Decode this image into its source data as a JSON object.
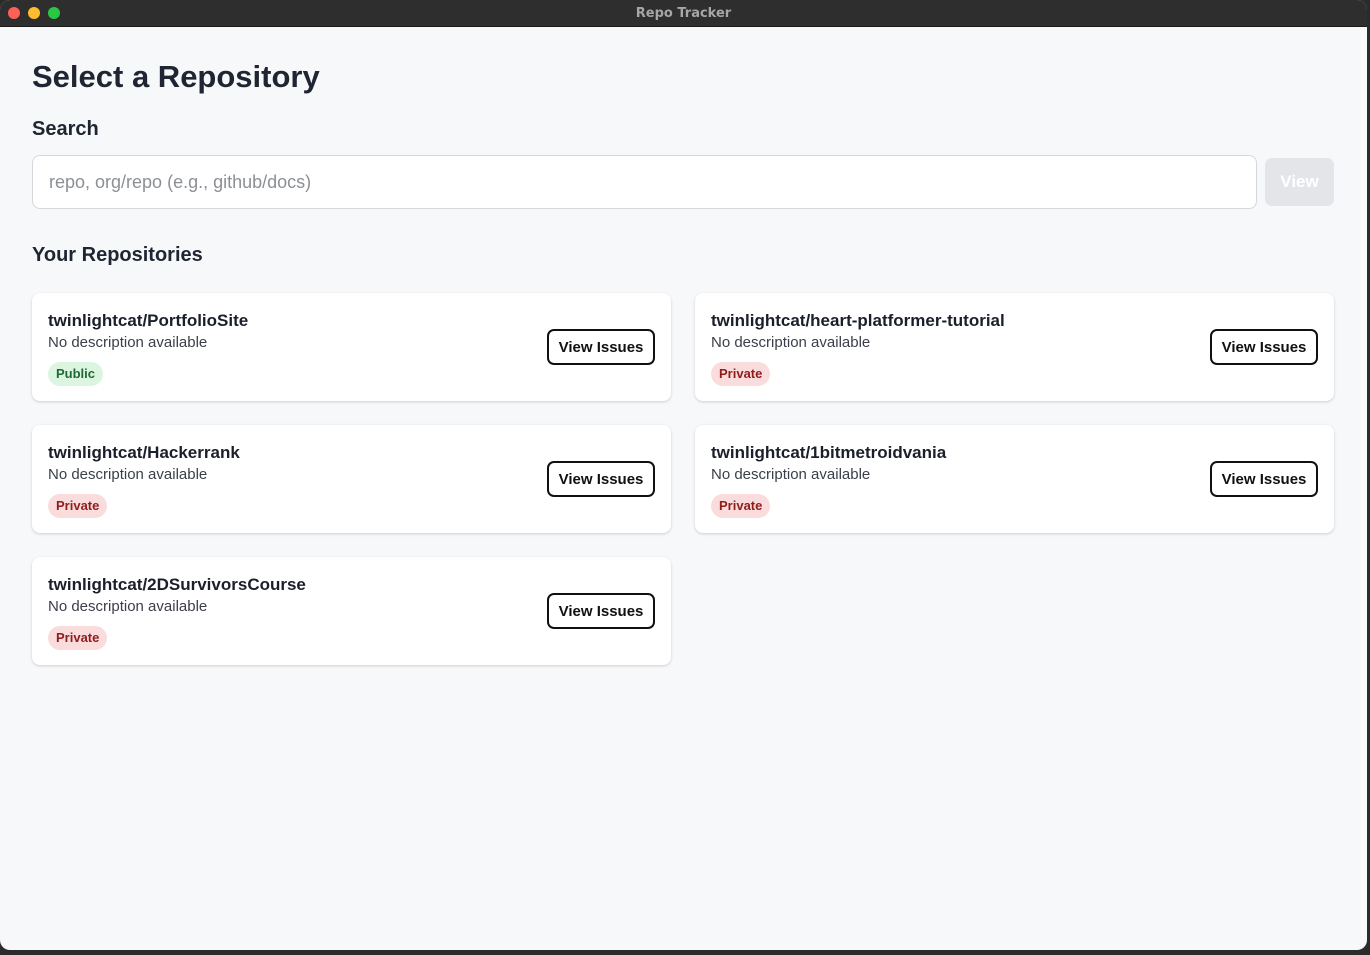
{
  "window": {
    "title": "Repo Tracker"
  },
  "page": {
    "title": "Select a Repository"
  },
  "search": {
    "label": "Search",
    "placeholder": "repo, org/repo (e.g., github/docs)",
    "value": "",
    "button_label": "View"
  },
  "repos_heading": "Your Repositories",
  "repos": [
    {
      "name": "twinlightcat/PortfolioSite",
      "description": "No description available",
      "visibility": "Public",
      "button_label": "View Issues"
    },
    {
      "name": "twinlightcat/heart-platformer-tutorial",
      "description": "No description available",
      "visibility": "Private",
      "button_label": "View Issues"
    },
    {
      "name": "twinlightcat/Hackerrank",
      "description": "No description available",
      "visibility": "Private",
      "button_label": "View Issues"
    },
    {
      "name": "twinlightcat/1bitmetroidvania",
      "description": "No description available",
      "visibility": "Private",
      "button_label": "View Issues"
    },
    {
      "name": "twinlightcat/2DSurvivorsCourse",
      "description": "No description available",
      "visibility": "Private",
      "button_label": "View Issues"
    }
  ],
  "colors": {
    "public_badge_bg": "#dcf5e1",
    "private_badge_bg": "#fadcdc"
  }
}
